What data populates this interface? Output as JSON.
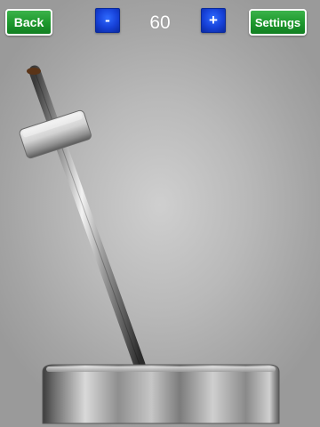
{
  "toolbar": {
    "back_label": "Back",
    "minus_label": "-",
    "tempo_value": "60",
    "plus_label": "+",
    "settings_label": "Settings"
  },
  "metronome": {
    "pendulum_icon": "metronome-pendulum-icon",
    "weight_icon": "pendulum-weight-icon",
    "base_icon": "metal-base-icon"
  },
  "colors": {
    "button_green": "#1f9a2f",
    "button_blue": "#1641d8",
    "background": "#b9b9b9"
  }
}
